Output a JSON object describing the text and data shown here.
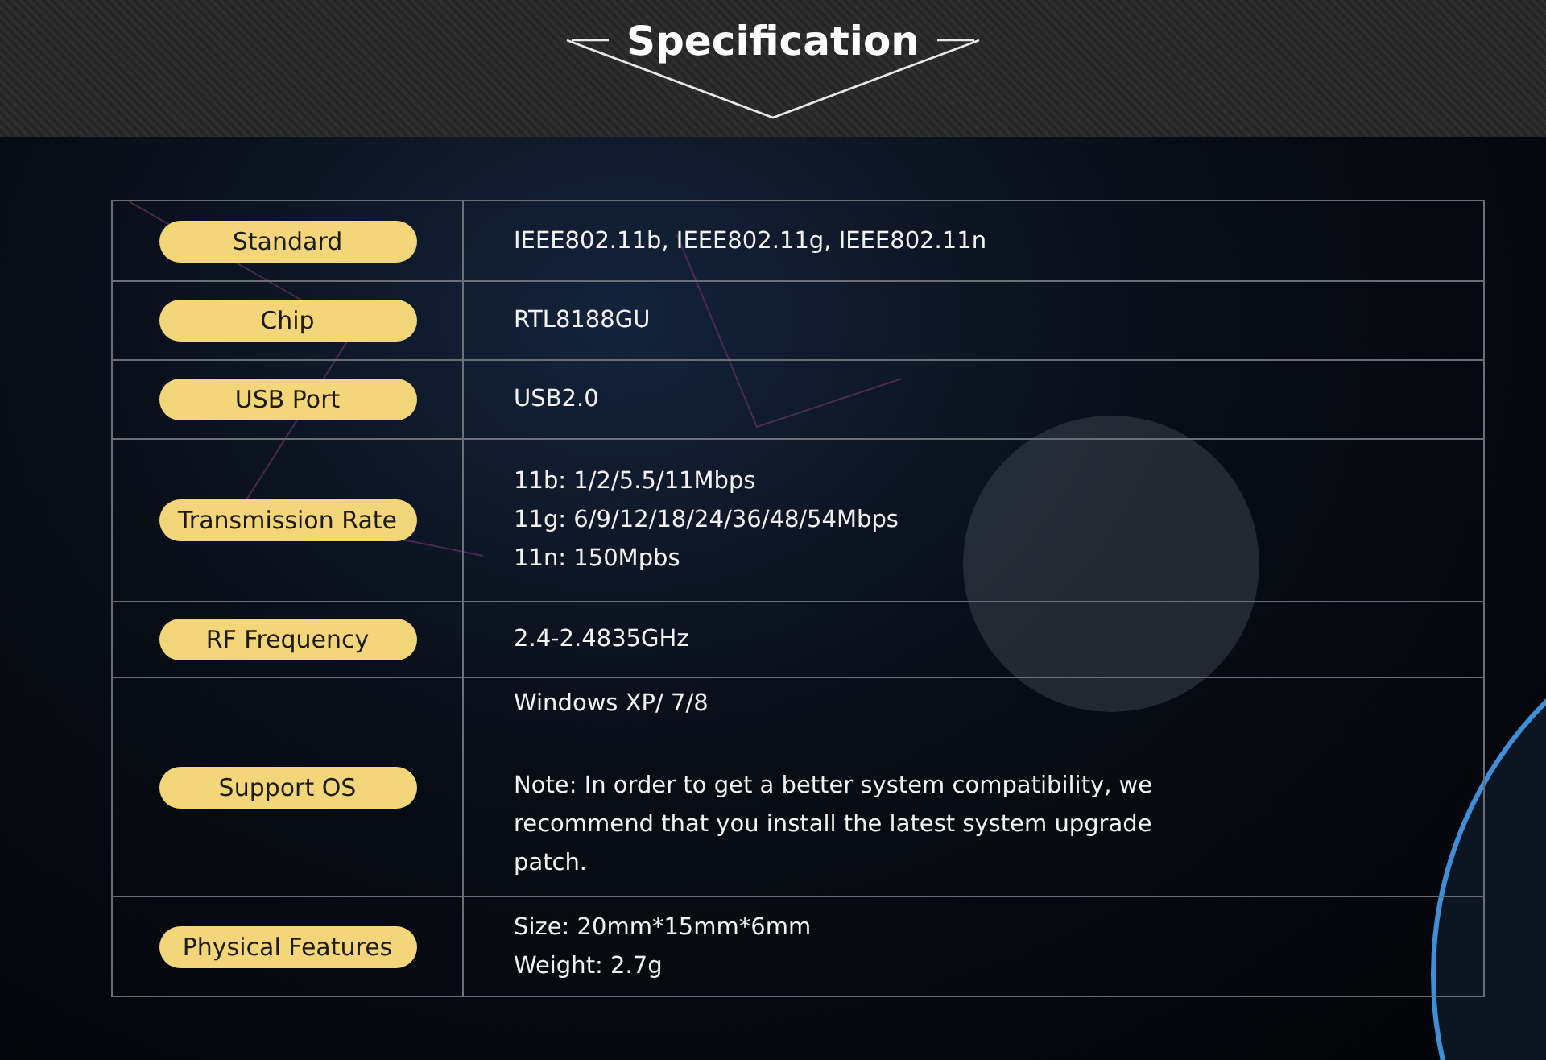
{
  "header": {
    "title": "Specification"
  },
  "specs": [
    {
      "label": "Standard",
      "lines": [
        "IEEE802.11b, IEEE802.11g, IEEE802.11n"
      ]
    },
    {
      "label": "Chip",
      "lines": [
        "RTL8188GU"
      ]
    },
    {
      "label": "USB Port",
      "lines": [
        "USB2.0"
      ]
    },
    {
      "label": "Transmission Rate",
      "lines": [
        "11b: 1/2/5.5/11Mbps",
        "11g: 6/9/12/18/24/36/48/54Mbps",
        "11n: 150Mpbs"
      ]
    },
    {
      "label": "RF Frequency",
      "lines": [
        "2.4-2.4835GHz"
      ]
    },
    {
      "label": "Support OS",
      "lines": [
        "Windows XP/ 7/8",
        "Note: In order to get a better system compatibility, we recommend that you install the latest system upgrade patch."
      ]
    },
    {
      "label": "Physical Features",
      "lines": [
        "Size: 20mm*15mm*6mm",
        "Weight: 2.7g"
      ]
    }
  ]
}
